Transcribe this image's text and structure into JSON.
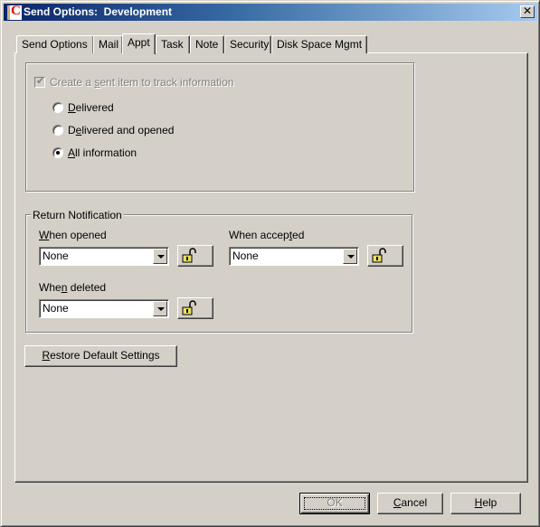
{
  "window": {
    "title": "Send Options:  Development",
    "app_icon": "c-app-icon",
    "close_label": "✕"
  },
  "tabs": [
    {
      "label": "Send Options",
      "active": false
    },
    {
      "label": "Mail",
      "active": false
    },
    {
      "label": "Appt",
      "active": true
    },
    {
      "label": "Task",
      "active": false
    },
    {
      "label": "Note",
      "active": false
    },
    {
      "label": "Security",
      "active": false
    },
    {
      "label": "Disk Space Mgmt",
      "active": false
    }
  ],
  "tracking": {
    "checkbox_label_pre": "Create a ",
    "checkbox_label_mn": "s",
    "checkbox_label_post": "ent item to track information",
    "checkbox_checked": true,
    "checkbox_disabled": true,
    "options": [
      {
        "mn": "D",
        "rest": "elivered",
        "pre": "",
        "checked": false
      },
      {
        "pre": "D",
        "mn": "e",
        "rest": "livered and opened",
        "checked": false
      },
      {
        "mn": "A",
        "rest": "ll information",
        "pre": "",
        "checked": true
      }
    ]
  },
  "return_notification": {
    "legend": "Return Notification",
    "when_opened": {
      "pre": "",
      "mn": "W",
      "post": "hen opened",
      "value": "None"
    },
    "when_accepted": {
      "pre": "When accep",
      "mn": "t",
      "post": "ed",
      "value": "None"
    },
    "when_deleted": {
      "pre": "Whe",
      "mn": "n",
      "post": " deleted",
      "value": "None"
    }
  },
  "restore_button": {
    "mn": "R",
    "rest": "estore Default Settings"
  },
  "footer": {
    "ok_label": "OK",
    "cancel_mn": "C",
    "cancel_rest": "ancel",
    "help_mn": "H",
    "help_rest": "elp"
  }
}
